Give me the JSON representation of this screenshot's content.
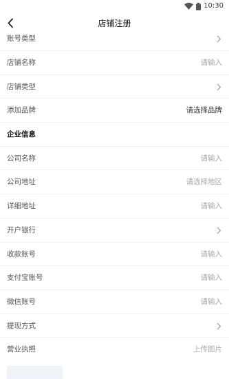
{
  "status": {
    "time": "10:30"
  },
  "nav": {
    "title": "店铺注册"
  },
  "fields": [
    {
      "label": "账号类型",
      "value": "",
      "type": "chevron"
    },
    {
      "label": "店铺名称",
      "value": "请输入",
      "type": "input"
    },
    {
      "label": "店铺类型",
      "value": "",
      "type": "chevron"
    },
    {
      "label": "添加品牌",
      "value": "请选择品牌",
      "type": "select-dark"
    }
  ],
  "section": {
    "title": "企业信息"
  },
  "company_fields": [
    {
      "label": "公司名称",
      "value": "请输入"
    },
    {
      "label": "公司地址",
      "value": "请选择地区"
    },
    {
      "label": "详细地址",
      "value": "请输入"
    },
    {
      "label": "开户银行",
      "value": ""
    },
    {
      "label": "收款账号",
      "value": "请输入"
    },
    {
      "label": "支付宝账号",
      "value": "请输入"
    },
    {
      "label": "微信账号",
      "value": "请输入"
    },
    {
      "label": "提现方式",
      "value": ""
    },
    {
      "label": "营业执照",
      "value": "上传图片"
    }
  ],
  "colors": {
    "background": "#ffffff",
    "divider": "#f1f1f1",
    "placeholder": "#a8a8a8",
    "upload": "#eef3f9"
  }
}
